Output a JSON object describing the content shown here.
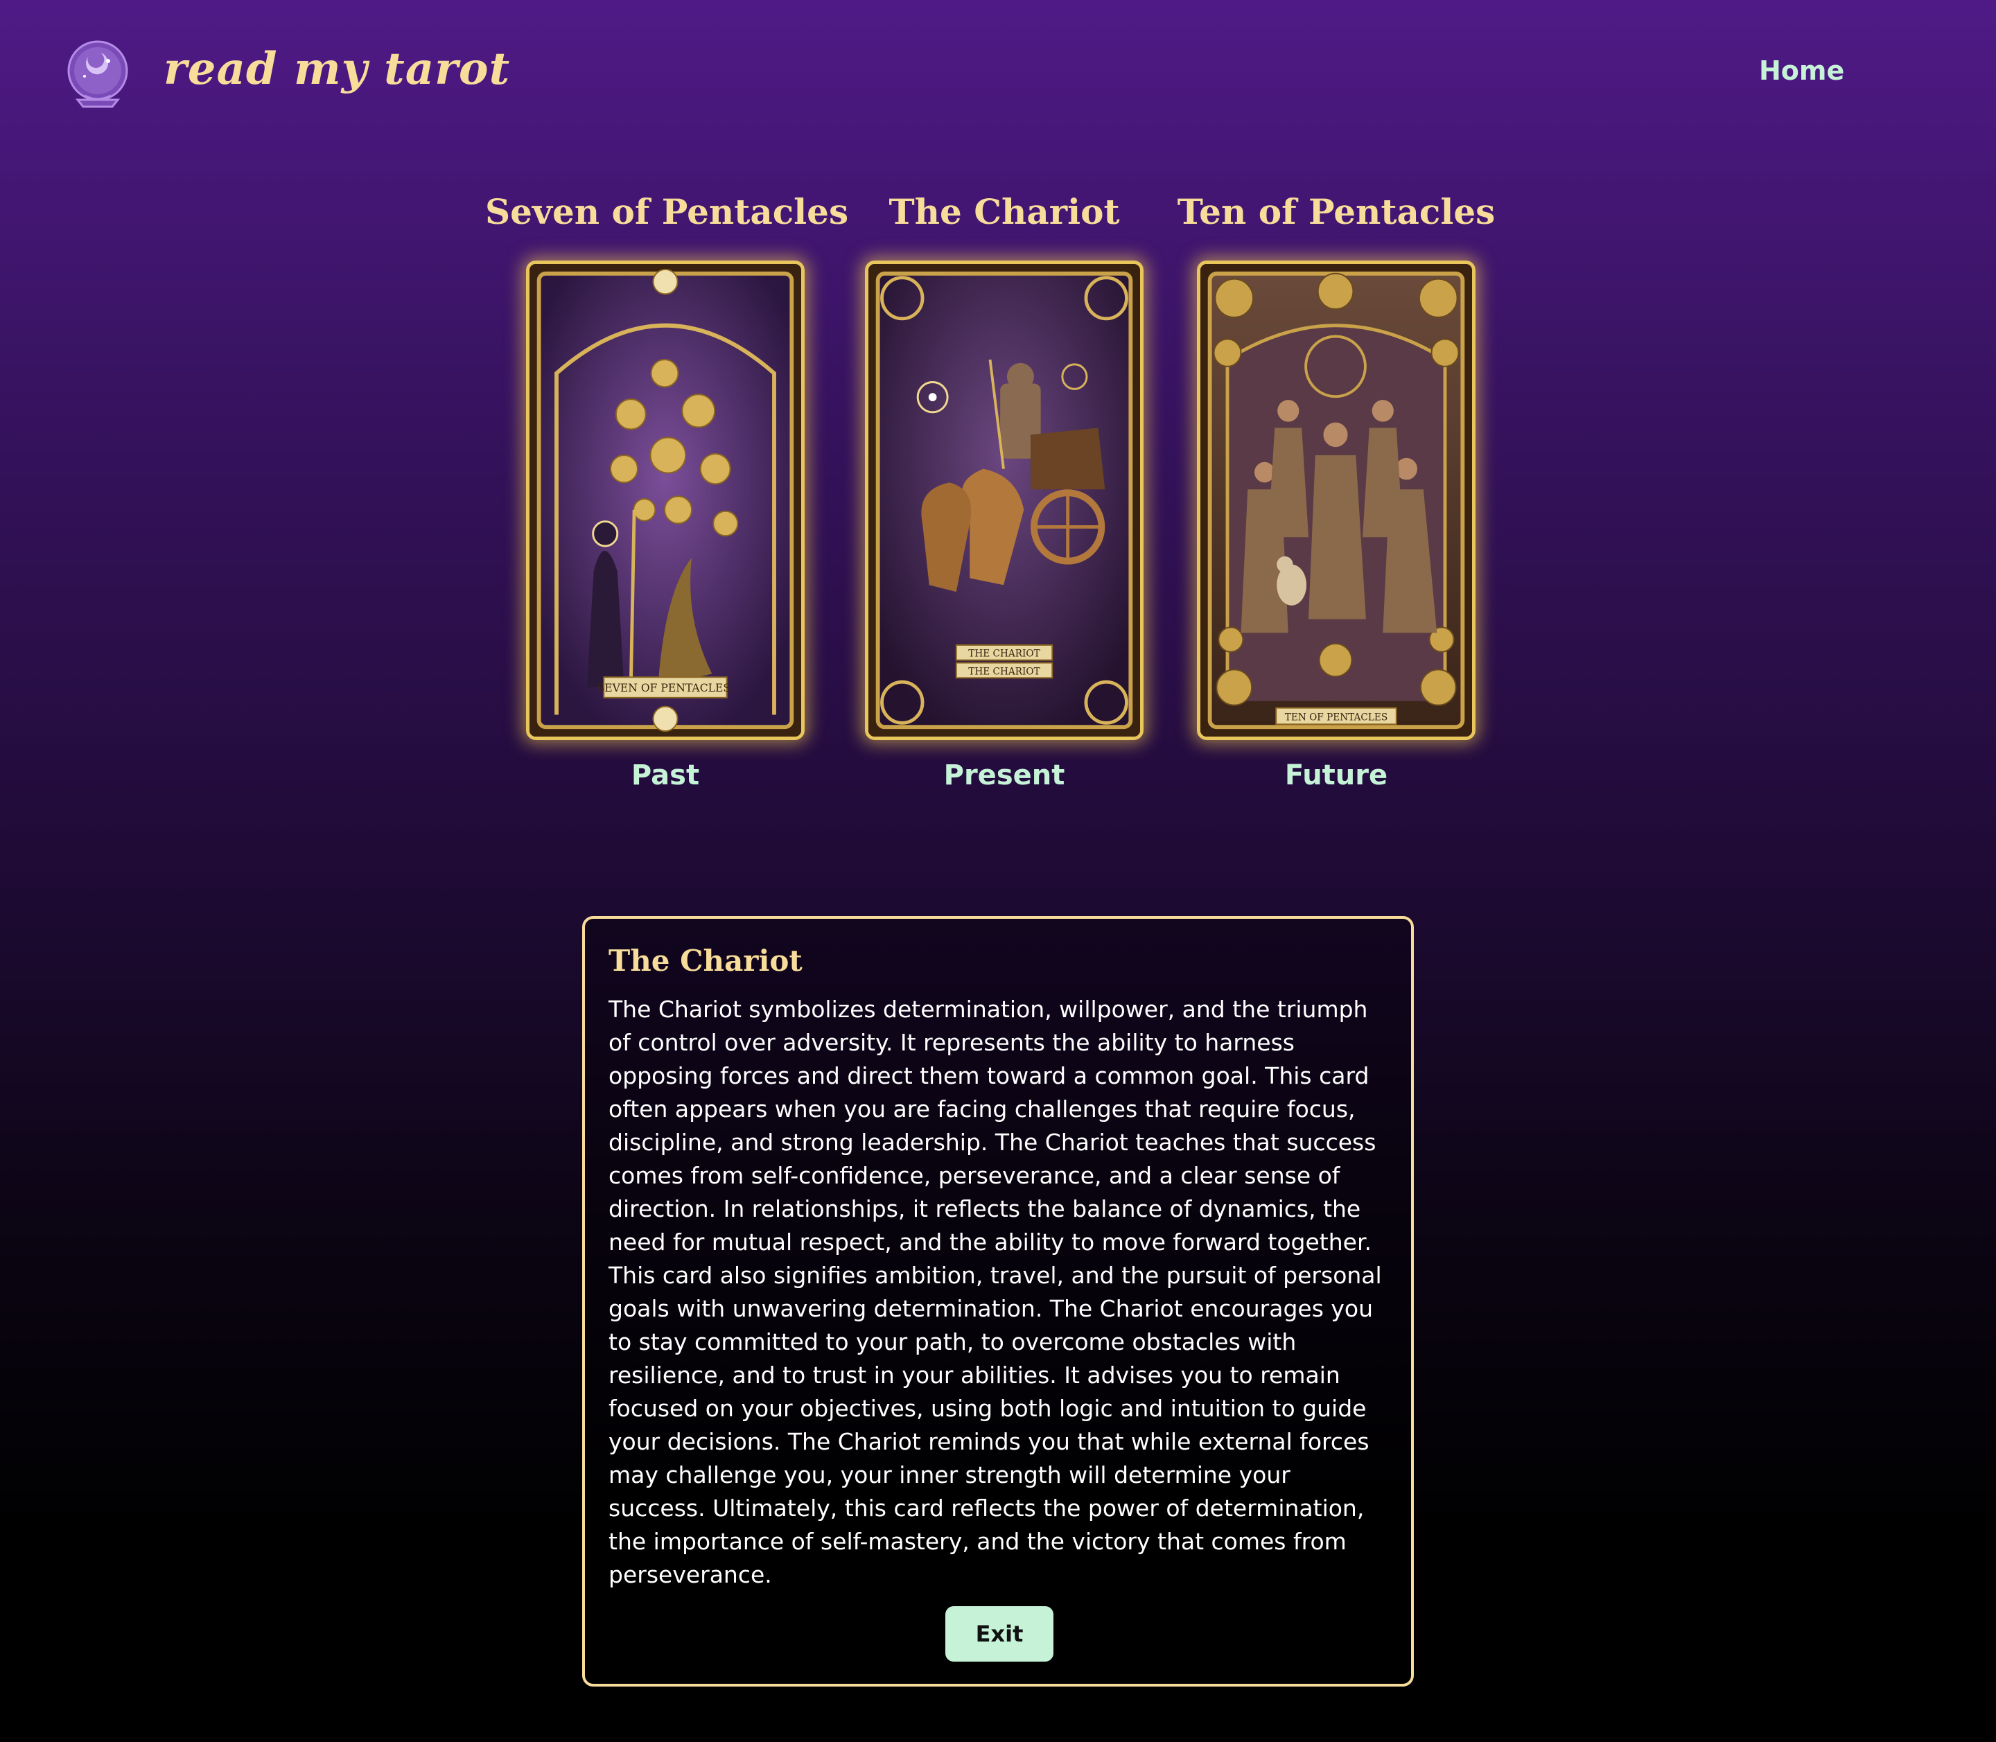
{
  "header": {
    "brand": "read my tarot",
    "nav": {
      "home_label": "Home"
    },
    "logo_icon": "crystal-ball-icon"
  },
  "cards": [
    {
      "title": "Seven of Pentacles",
      "position": "Past",
      "image_caption": "SEVEN OF PENTACLES."
    },
    {
      "title": "The Chariot",
      "position": "Present",
      "image_caption": "THE CHARIOT"
    },
    {
      "title": "Ten of Pentacles",
      "position": "Future",
      "image_caption": "TEN OF PENTACLES"
    }
  ],
  "detail": {
    "title": "The Chariot",
    "text": "The Chariot symbolizes determination, willpower, and the triumph of control over adversity. It represents the ability to harness opposing forces and direct them toward a common goal. This card often appears when you are facing challenges that require focus, discipline, and strong leadership. The Chariot teaches that success comes from self-confidence, perseverance, and a clear sense of direction. In relationships, it reflects the balance of dynamics, the need for mutual respect, and the ability to move forward together. This card also signifies ambition, travel, and the pursuit of personal goals with unwavering determination. The Chariot encourages you to stay committed to your path, to overcome obstacles with resilience, and to trust in your abilities. It advises you to remain focused on your objectives, using both logic and intuition to guide your decisions. The Chariot reminds you that while external forces may challenge you, your inner strength will determine your success. Ultimately, this card reflects the power of determination, the importance of self-mastery, and the victory that comes from perseverance.",
    "exit_label": "Exit"
  },
  "colors": {
    "gold": "#f7dc9a",
    "mint": "#c6f3d8",
    "card_border": "#e9c65b"
  }
}
